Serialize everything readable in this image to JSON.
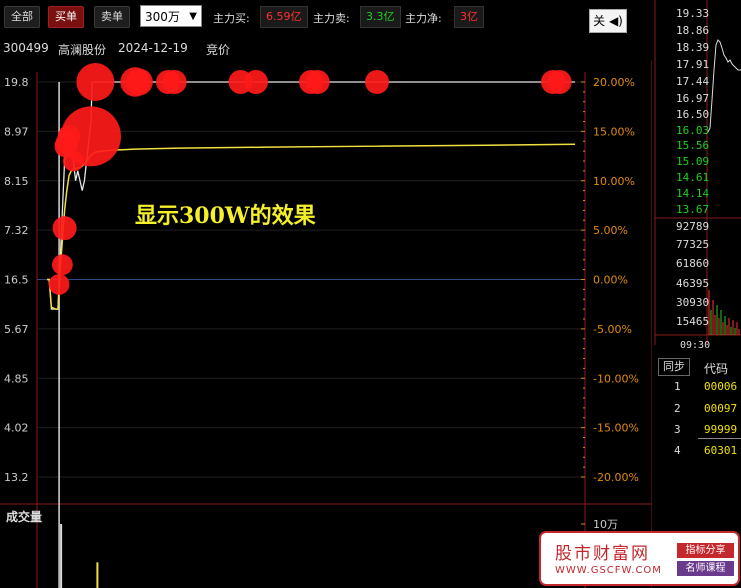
{
  "toolbar": {
    "tab_all": "全部",
    "tab_buy": "买单",
    "tab_sell": "卖单",
    "threshold_selected": "300万",
    "main_buy_label": "主力买:",
    "main_buy_value": "6.59亿",
    "main_sell_label": "主力卖:",
    "main_sell_value": "3.3亿",
    "main_net_label": "主力净:",
    "main_net_value": "3亿",
    "close_label": "关"
  },
  "stock": {
    "code": "300499",
    "name": "高澜股份",
    "date": "2024-12-19",
    "mode": "竞价"
  },
  "colors": {
    "up": "#ff2b2b",
    "down": "#22cc22",
    "avg_line": "#f0e040",
    "price_line": "#e6e6e6",
    "axis_right": "#e08a10",
    "bubble": "#ff1a1a"
  },
  "chart_data": {
    "type": "line",
    "annotation": "显示300W的效果",
    "volume_label": "成交量",
    "volume_axis_top": "10万",
    "left_ticks": [
      "19.8",
      "8.97",
      "8.15",
      "7.32",
      "16.5",
      "5.67",
      "4.85",
      "4.02",
      "13.2"
    ],
    "right_ticks": [
      "20.00%",
      "15.00%",
      "10.00%",
      "5.00%",
      "0.00%",
      "-5.00%",
      "-10.00%",
      "-15.00%",
      "-20.00%"
    ],
    "y_range_percent": [
      -20,
      20
    ],
    "x_range_minutes": [
      0,
      240
    ],
    "series": [
      {
        "role": "price",
        "x": [
          0,
          1,
          2,
          3,
          4,
          5,
          5.5,
          6,
          7,
          8,
          9,
          10,
          11,
          12,
          13,
          14,
          15,
          16,
          17,
          18,
          19,
          20,
          20.5,
          21,
          21.5,
          22,
          30,
          60,
          100,
          150,
          200,
          240
        ],
        "y": [
          0,
          0,
          -3,
          -3,
          -3,
          -3,
          0,
          2,
          7,
          12,
          14,
          15,
          13,
          12,
          10,
          11,
          10,
          9,
          10,
          12,
          14,
          16,
          20,
          20,
          20,
          20,
          20,
          20,
          20,
          20,
          20,
          20
        ]
      },
      {
        "role": "average",
        "x": [
          0,
          1,
          2,
          3,
          4,
          5,
          5.5,
          6,
          7,
          8,
          9,
          10,
          11,
          12,
          13,
          14,
          15,
          16,
          17,
          18,
          19,
          20,
          22,
          25,
          30,
          40,
          60,
          100,
          150,
          200,
          240
        ],
        "y": [
          0,
          0,
          -2.8,
          -2.9,
          -3,
          -3,
          -1,
          1,
          4,
          7,
          9,
          10.5,
          11,
          11.2,
          11.2,
          11.3,
          11.3,
          11.5,
          11.7,
          12,
          12.3,
          12.6,
          12.9,
          13.0,
          13.1,
          13.2,
          13.3,
          13.4,
          13.5,
          13.6,
          13.7
        ]
      }
    ],
    "bubbles": {
      "x": [
        5.5,
        7,
        8,
        8.5,
        9,
        10,
        12,
        20,
        22,
        40,
        42,
        55,
        58,
        88,
        95,
        120,
        123,
        150,
        230,
        233
      ],
      "y": [
        -0.5,
        1.5,
        5.2,
        13.5,
        13.8,
        14.5,
        12,
        14.5,
        20,
        20,
        20,
        20,
        20,
        20,
        20,
        20,
        20,
        20,
        20,
        20
      ],
      "amount_wan": [
        300,
        300,
        400,
        350,
        350,
        350,
        300,
        2500,
        1000,
        600,
        500,
        400,
        400,
        400,
        400,
        400,
        400,
        400,
        400,
        400
      ]
    },
    "volume": {
      "x": [
        5.5,
        22
      ],
      "y": [
        10,
        4
      ]
    }
  },
  "mini_chart": {
    "price_ticks": [
      "19.33",
      "18.86",
      "18.39",
      "17.91",
      "17.44",
      "16.97",
      "16.50",
      "16.03",
      "15.56",
      "15.09",
      "14.61",
      "14.14",
      "13.67"
    ],
    "volume_ticks": [
      "92789",
      "77325",
      "61860",
      "46395",
      "30930",
      "15465"
    ],
    "time_label": "09:30"
  },
  "side_table": {
    "sync_label": "同步",
    "code_header": "代码",
    "rows": [
      {
        "index": "1",
        "code": "00006"
      },
      {
        "index": "2",
        "code": "00097"
      },
      {
        "index": "3",
        "code": "99999"
      },
      {
        "index": "4",
        "code": "60301"
      }
    ]
  },
  "watermark": {
    "name": "股市财富网",
    "url": "WWW.GSCFW.COM",
    "tag1": "指标分享",
    "tag2": "名师课程"
  }
}
